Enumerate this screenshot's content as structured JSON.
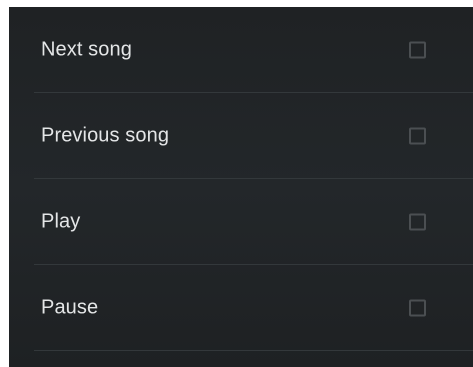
{
  "options": [
    {
      "label": "Next song",
      "checked": false
    },
    {
      "label": "Previous song",
      "checked": false
    },
    {
      "label": "Play",
      "checked": false
    },
    {
      "label": "Pause",
      "checked": false
    }
  ],
  "colors": {
    "background": "#222527",
    "text": "#e4e6e7",
    "checkbox_border": "#4b4f52",
    "divider": "#33383b"
  }
}
